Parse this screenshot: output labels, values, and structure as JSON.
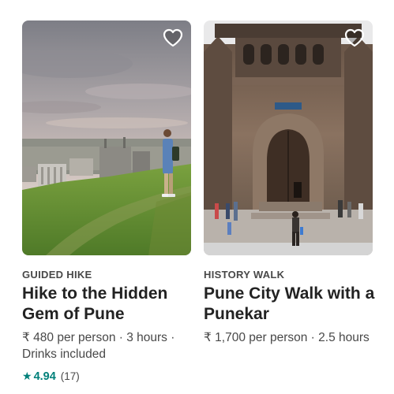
{
  "cards": [
    {
      "category": "GUIDED HIKE",
      "title": "Hike to the Hidden Gem of Pune",
      "details": "₹ 480 per person · 3 hours · Drinks included",
      "rating": {
        "star_icon": "star-icon",
        "score": "4.94",
        "count": "(17)"
      },
      "wishlist_icon": "heart-outline-icon",
      "image_subject": "hiker on grassy hill overlooking city",
      "accent_color": "#00807a"
    },
    {
      "category": "HISTORY WALK",
      "title": "Pune City Walk with a Punekar",
      "details": "₹ 1,700 per person · 2.5 hours",
      "wishlist_icon": "heart-outline-icon",
      "image_subject": "stone fort gateway with visitors",
      "accent_color": "#00807a"
    }
  ]
}
